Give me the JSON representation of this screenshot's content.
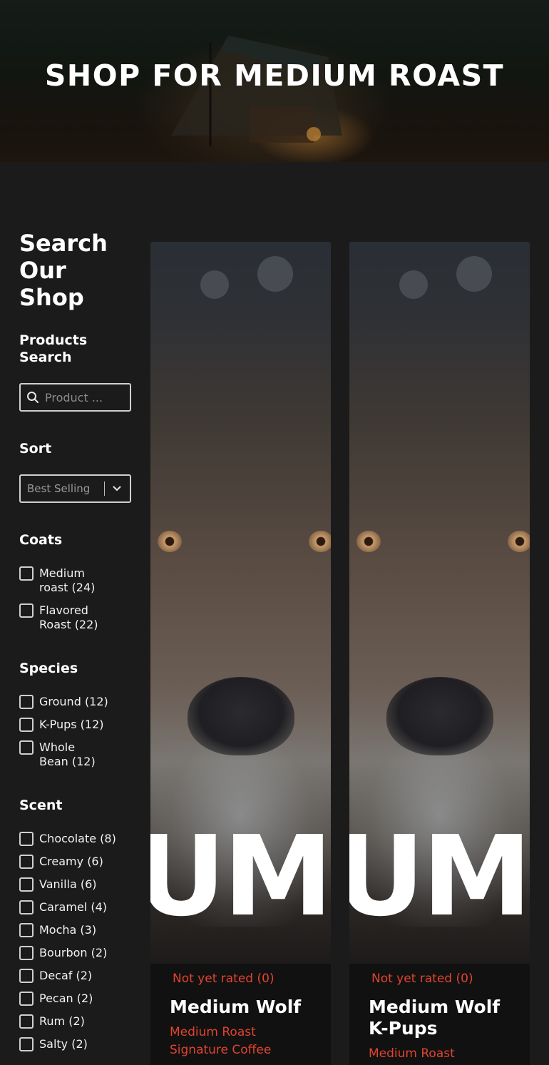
{
  "hero": {
    "title": "SHOP FOR MEDIUM ROAST"
  },
  "sidebar": {
    "title": "Search Our Shop",
    "products_search": {
      "label": "Products Search",
      "placeholder": "Product ..."
    },
    "sort": {
      "label": "Sort",
      "selected": "Best Selling"
    },
    "coats": {
      "label": "Coats",
      "items": [
        {
          "label": "Medium roast (24)"
        },
        {
          "label": "Flavored Roast (22)"
        }
      ]
    },
    "species": {
      "label": "Species",
      "items": [
        {
          "label": "Ground (12)"
        },
        {
          "label": "K-Pups (12)"
        },
        {
          "label": "Whole Bean (12)"
        }
      ]
    },
    "scent": {
      "label": "Scent",
      "items": [
        {
          "label": "Chocolate (8)"
        },
        {
          "label": "Creamy (6)"
        },
        {
          "label": "Vanilla (6)"
        },
        {
          "label": "Caramel (4)"
        },
        {
          "label": "Mocha (3)"
        },
        {
          "label": "Bourbon (2)"
        },
        {
          "label": "Decaf (2)"
        },
        {
          "label": "Pecan (2)"
        },
        {
          "label": "Rum (2)"
        },
        {
          "label": "Salty (2)"
        }
      ]
    }
  },
  "products": [
    {
      "image_text": "UM I",
      "rating": "Not yet rated (0)",
      "title": "Medium Wolf",
      "category": "Medium Roast Signature Coffee"
    },
    {
      "image_text": "UM I",
      "rating": "Not yet rated (0)",
      "title": "Medium Wolf K-Pups",
      "category": "Medium Roast"
    }
  ],
  "colors": {
    "background": "#1b1b1b",
    "accent": "#e0442f",
    "card_body": "#111111"
  }
}
